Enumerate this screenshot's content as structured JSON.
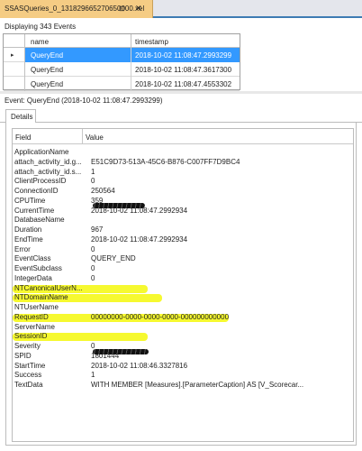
{
  "tab": {
    "title": "SSASQueries_0_131829665270650000.xel",
    "pin": "⊡",
    "close": "✕"
  },
  "status": "Displaying 343 Events",
  "events": {
    "columns": [
      "name",
      "timestamp"
    ],
    "rows": [
      {
        "marker": "▸",
        "name": "QueryEnd",
        "timestamp": "2018-10-02 11:08:47.2993299",
        "selected": true
      },
      {
        "marker": "",
        "name": "QueryEnd",
        "timestamp": "2018-10-02 11:08:47.3617300",
        "selected": false
      },
      {
        "marker": "",
        "name": "QueryEnd",
        "timestamp": "2018-10-02 11:08:47.4553302",
        "selected": false
      }
    ]
  },
  "event_title": "Event: QueryEnd (2018-10-02 11:08:47.2993299)",
  "details": {
    "tab_label": "Details",
    "columns": [
      "Field",
      "Value"
    ],
    "rows": [
      {
        "field": "ApplicationName",
        "value": ""
      },
      {
        "field": "attach_activity_id.g...",
        "value": "E51C9D73-513A-45C6-B876-C007FF7D9BC4"
      },
      {
        "field": "attach_activity_id.s...",
        "value": "1"
      },
      {
        "field": "ClientProcessID",
        "value": "0"
      },
      {
        "field": "ConnectionID",
        "value": "250564"
      },
      {
        "field": "CPUTime",
        "value": "359"
      },
      {
        "field": "CurrentTime",
        "value": "2018-10-02 11:08:47.2992934"
      },
      {
        "field": "DatabaseName",
        "value": ""
      },
      {
        "field": "Duration",
        "value": "967"
      },
      {
        "field": "EndTime",
        "value": "2018-10-02 11:08:47.2992934"
      },
      {
        "field": "Error",
        "value": "0"
      },
      {
        "field": "EventClass",
        "value": "QUERY_END"
      },
      {
        "field": "EventSubclass",
        "value": "0"
      },
      {
        "field": "IntegerData",
        "value": "0"
      },
      {
        "field": "NTCanonicalUserN...",
        "value": ""
      },
      {
        "field": "NTDomainName",
        "value": ""
      },
      {
        "field": "NTUserName",
        "value": ""
      },
      {
        "field": "RequestID",
        "value": "00000000-0000-0000-0000-000000000000"
      },
      {
        "field": "ServerName",
        "value": ""
      },
      {
        "field": "SessionID",
        "value": ""
      },
      {
        "field": "Severity",
        "value": "0"
      },
      {
        "field": "SPID",
        "value": "1801444"
      },
      {
        "field": "StartTime",
        "value": "2018-10-02 11:08:46.3327816"
      },
      {
        "field": "Success",
        "value": "1"
      },
      {
        "field": "TextData",
        "value": "WITH MEMBER [Measures].[ParameterCaption] AS [V_Scorecar..."
      }
    ]
  },
  "colors": {
    "highlight": "#f6f930",
    "selection": "#3399ff",
    "tab_active": "#f5cc84",
    "tab_accent": "#3d7bb3"
  }
}
